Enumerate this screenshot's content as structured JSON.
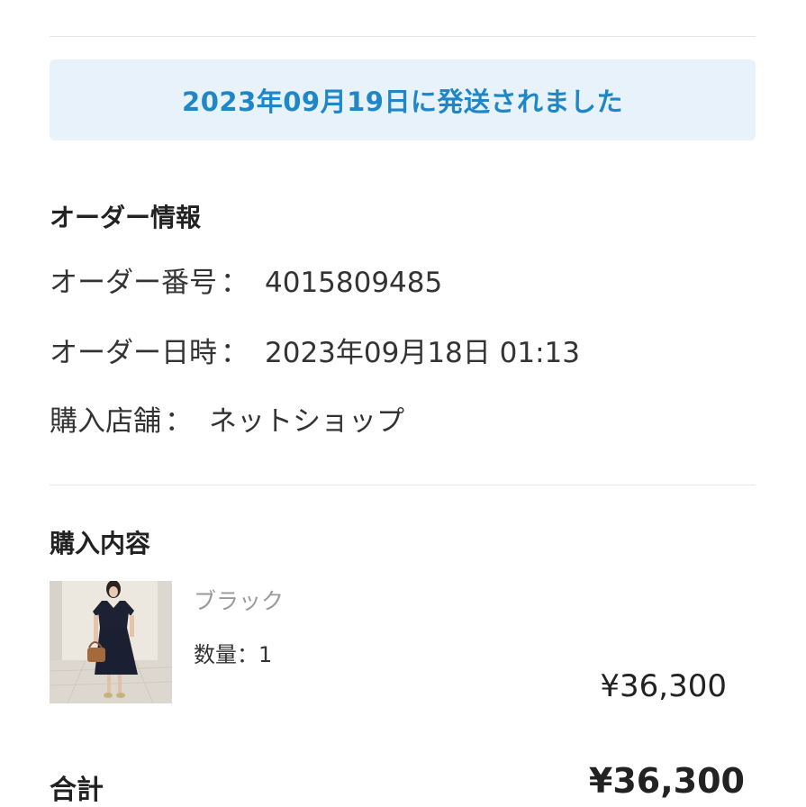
{
  "shipping_banner": {
    "text": "2023年09月19日に発送されました"
  },
  "order_info": {
    "title": "オーダー情報",
    "order_number_label": "オーダー番号",
    "order_number": "4015809485",
    "order_datetime_label": "オーダー日時",
    "order_datetime": "2023年09月18日 01:13",
    "store_label": "購入店舗",
    "store": "ネットショップ",
    "separator": "："
  },
  "purchase": {
    "title": "購入内容",
    "items": [
      {
        "color": "ブラック",
        "quantity_label": "数量：1",
        "price": "¥36,300"
      }
    ]
  },
  "total": {
    "label": "合計",
    "value": "¥36,300"
  },
  "colors": {
    "banner_bg": "#e8f2fa",
    "banner_text": "#1f86c8",
    "divider": "#e6e6e6"
  }
}
